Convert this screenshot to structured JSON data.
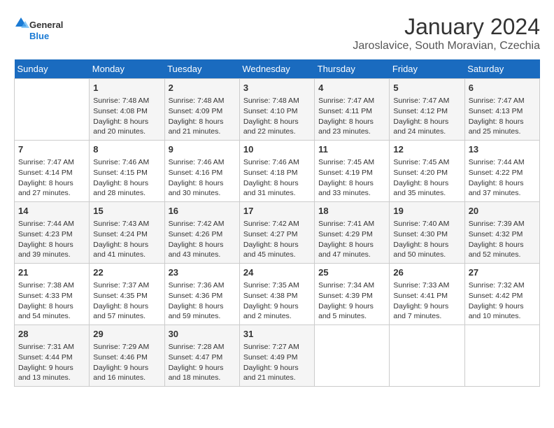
{
  "logo": {
    "general": "General",
    "blue": "Blue"
  },
  "title": "January 2024",
  "subtitle": "Jaroslavice, South Moravian, Czechia",
  "days_of_week": [
    "Sunday",
    "Monday",
    "Tuesday",
    "Wednesday",
    "Thursday",
    "Friday",
    "Saturday"
  ],
  "weeks": [
    [
      {
        "day": "",
        "info": ""
      },
      {
        "day": "1",
        "info": "Sunrise: 7:48 AM\nSunset: 4:08 PM\nDaylight: 8 hours\nand 20 minutes."
      },
      {
        "day": "2",
        "info": "Sunrise: 7:48 AM\nSunset: 4:09 PM\nDaylight: 8 hours\nand 21 minutes."
      },
      {
        "day": "3",
        "info": "Sunrise: 7:48 AM\nSunset: 4:10 PM\nDaylight: 8 hours\nand 22 minutes."
      },
      {
        "day": "4",
        "info": "Sunrise: 7:47 AM\nSunset: 4:11 PM\nDaylight: 8 hours\nand 23 minutes."
      },
      {
        "day": "5",
        "info": "Sunrise: 7:47 AM\nSunset: 4:12 PM\nDaylight: 8 hours\nand 24 minutes."
      },
      {
        "day": "6",
        "info": "Sunrise: 7:47 AM\nSunset: 4:13 PM\nDaylight: 8 hours\nand 25 minutes."
      }
    ],
    [
      {
        "day": "7",
        "info": "Sunrise: 7:47 AM\nSunset: 4:14 PM\nDaylight: 8 hours\nand 27 minutes."
      },
      {
        "day": "8",
        "info": "Sunrise: 7:46 AM\nSunset: 4:15 PM\nDaylight: 8 hours\nand 28 minutes."
      },
      {
        "day": "9",
        "info": "Sunrise: 7:46 AM\nSunset: 4:16 PM\nDaylight: 8 hours\nand 30 minutes."
      },
      {
        "day": "10",
        "info": "Sunrise: 7:46 AM\nSunset: 4:18 PM\nDaylight: 8 hours\nand 31 minutes."
      },
      {
        "day": "11",
        "info": "Sunrise: 7:45 AM\nSunset: 4:19 PM\nDaylight: 8 hours\nand 33 minutes."
      },
      {
        "day": "12",
        "info": "Sunrise: 7:45 AM\nSunset: 4:20 PM\nDaylight: 8 hours\nand 35 minutes."
      },
      {
        "day": "13",
        "info": "Sunrise: 7:44 AM\nSunset: 4:22 PM\nDaylight: 8 hours\nand 37 minutes."
      }
    ],
    [
      {
        "day": "14",
        "info": "Sunrise: 7:44 AM\nSunset: 4:23 PM\nDaylight: 8 hours\nand 39 minutes."
      },
      {
        "day": "15",
        "info": "Sunrise: 7:43 AM\nSunset: 4:24 PM\nDaylight: 8 hours\nand 41 minutes."
      },
      {
        "day": "16",
        "info": "Sunrise: 7:42 AM\nSunset: 4:26 PM\nDaylight: 8 hours\nand 43 minutes."
      },
      {
        "day": "17",
        "info": "Sunrise: 7:42 AM\nSunset: 4:27 PM\nDaylight: 8 hours\nand 45 minutes."
      },
      {
        "day": "18",
        "info": "Sunrise: 7:41 AM\nSunset: 4:29 PM\nDaylight: 8 hours\nand 47 minutes."
      },
      {
        "day": "19",
        "info": "Sunrise: 7:40 AM\nSunset: 4:30 PM\nDaylight: 8 hours\nand 50 minutes."
      },
      {
        "day": "20",
        "info": "Sunrise: 7:39 AM\nSunset: 4:32 PM\nDaylight: 8 hours\nand 52 minutes."
      }
    ],
    [
      {
        "day": "21",
        "info": "Sunrise: 7:38 AM\nSunset: 4:33 PM\nDaylight: 8 hours\nand 54 minutes."
      },
      {
        "day": "22",
        "info": "Sunrise: 7:37 AM\nSunset: 4:35 PM\nDaylight: 8 hours\nand 57 minutes."
      },
      {
        "day": "23",
        "info": "Sunrise: 7:36 AM\nSunset: 4:36 PM\nDaylight: 8 hours\nand 59 minutes."
      },
      {
        "day": "24",
        "info": "Sunrise: 7:35 AM\nSunset: 4:38 PM\nDaylight: 9 hours\nand 2 minutes."
      },
      {
        "day": "25",
        "info": "Sunrise: 7:34 AM\nSunset: 4:39 PM\nDaylight: 9 hours\nand 5 minutes."
      },
      {
        "day": "26",
        "info": "Sunrise: 7:33 AM\nSunset: 4:41 PM\nDaylight: 9 hours\nand 7 minutes."
      },
      {
        "day": "27",
        "info": "Sunrise: 7:32 AM\nSunset: 4:42 PM\nDaylight: 9 hours\nand 10 minutes."
      }
    ],
    [
      {
        "day": "28",
        "info": "Sunrise: 7:31 AM\nSunset: 4:44 PM\nDaylight: 9 hours\nand 13 minutes."
      },
      {
        "day": "29",
        "info": "Sunrise: 7:29 AM\nSunset: 4:46 PM\nDaylight: 9 hours\nand 16 minutes."
      },
      {
        "day": "30",
        "info": "Sunrise: 7:28 AM\nSunset: 4:47 PM\nDaylight: 9 hours\nand 18 minutes."
      },
      {
        "day": "31",
        "info": "Sunrise: 7:27 AM\nSunset: 4:49 PM\nDaylight: 9 hours\nand 21 minutes."
      },
      {
        "day": "",
        "info": ""
      },
      {
        "day": "",
        "info": ""
      },
      {
        "day": "",
        "info": ""
      }
    ]
  ]
}
